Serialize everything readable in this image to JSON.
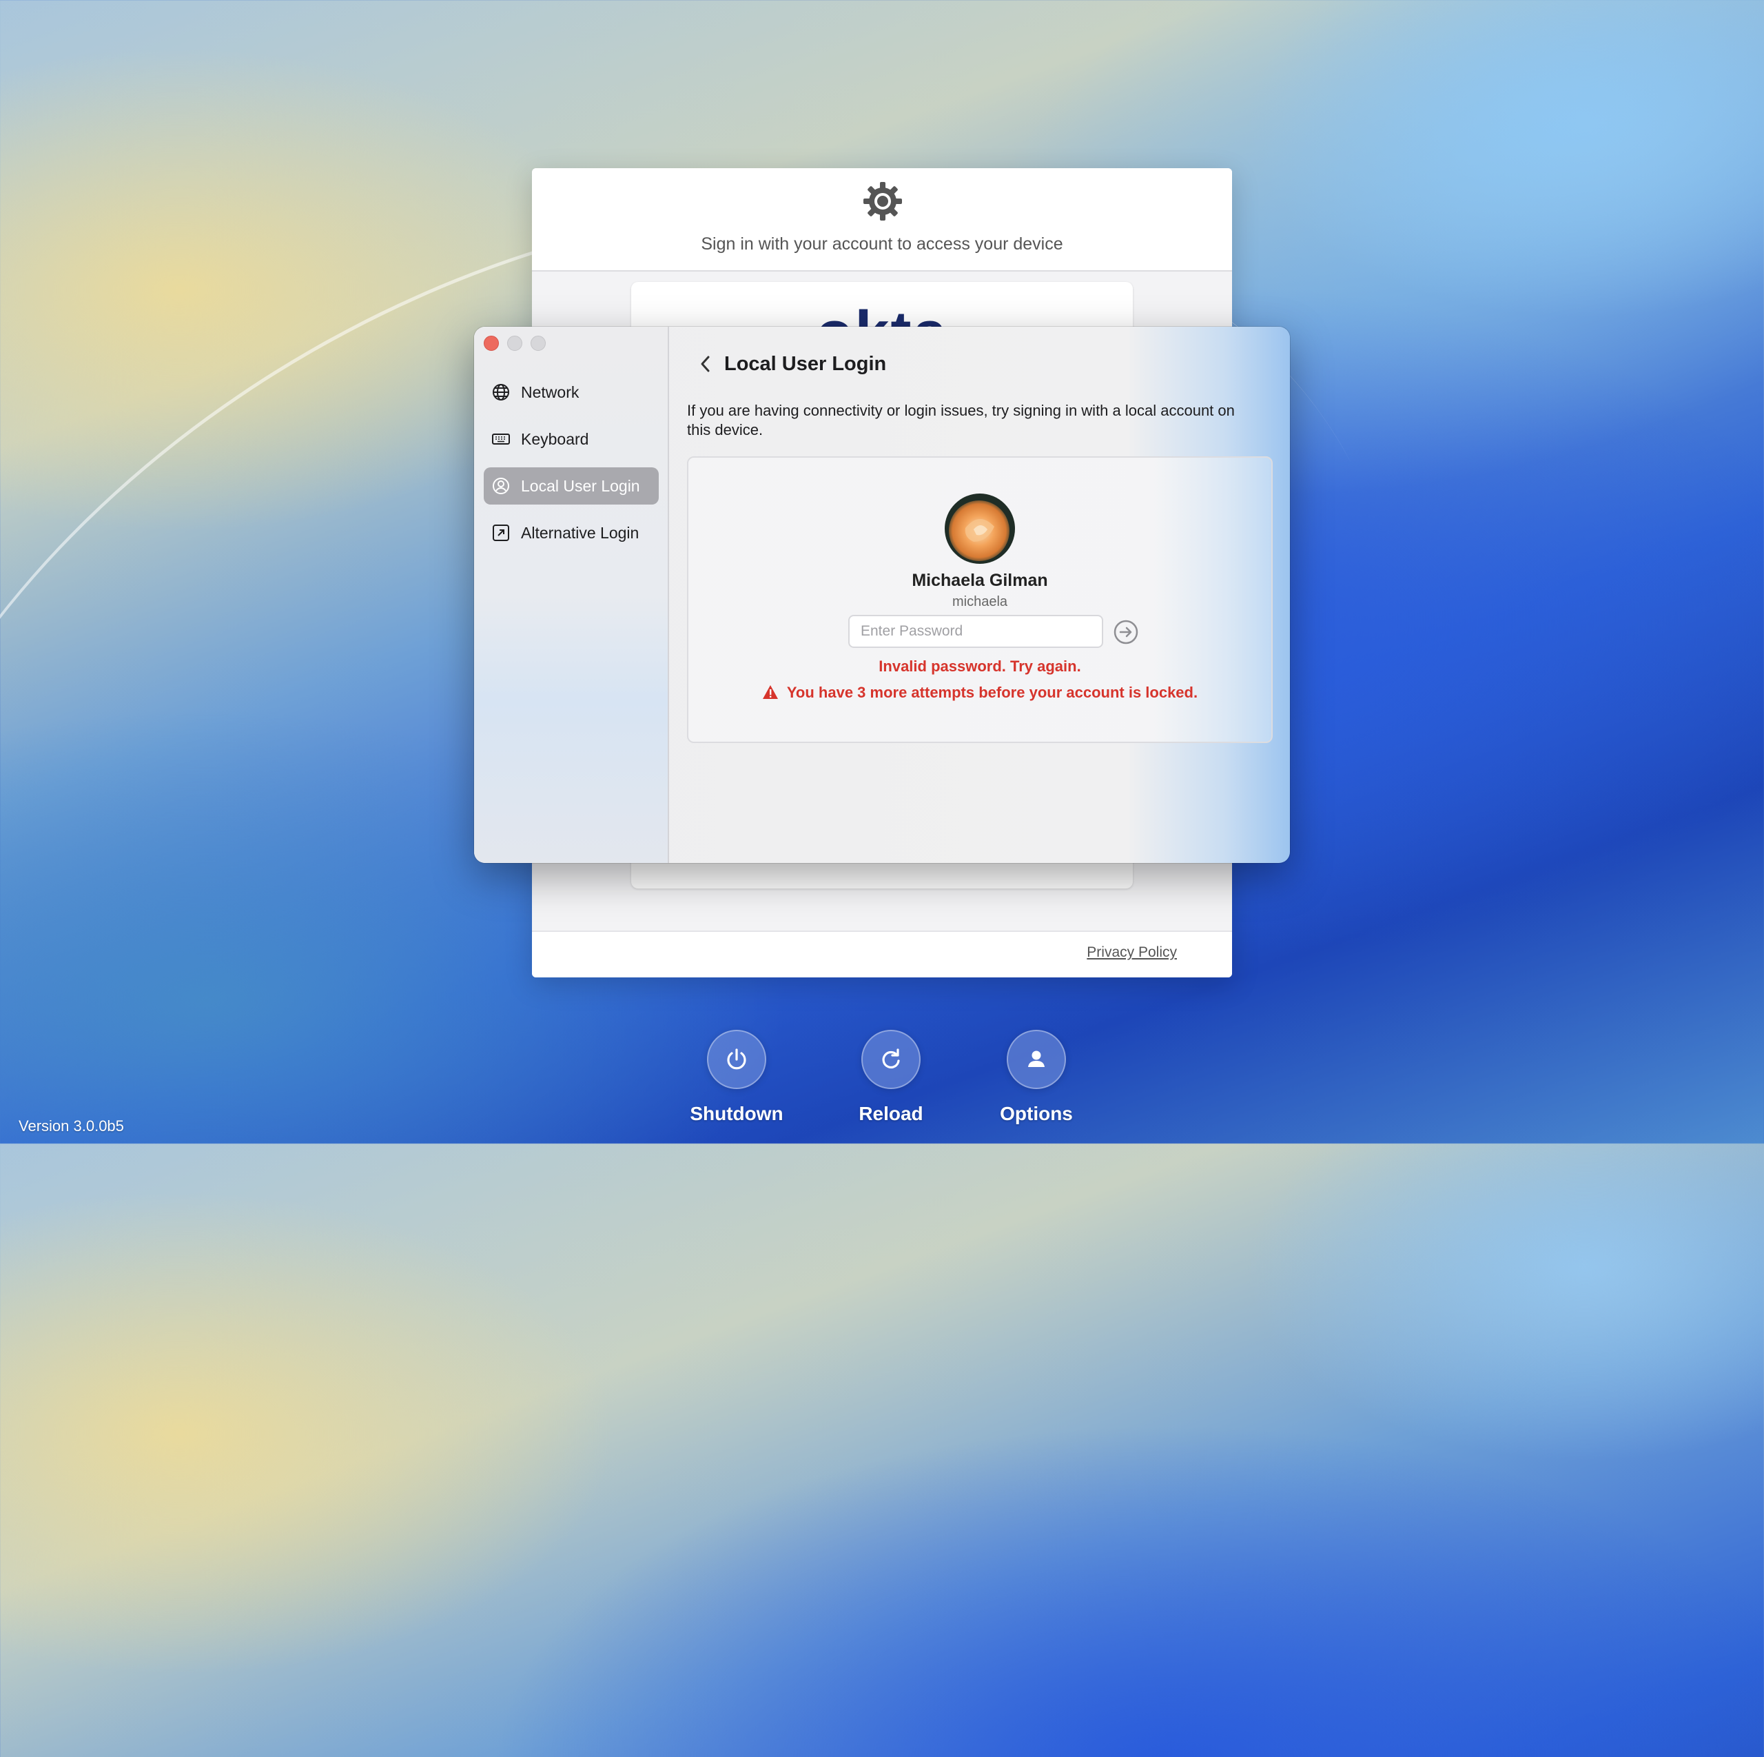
{
  "background": {
    "subtitle": "Sign in with your account to access your device",
    "okta_logo": "okta",
    "privacy_link": "Privacy Policy"
  },
  "dialog": {
    "sidebar": {
      "items": [
        {
          "label": "Network",
          "icon": "globe-icon",
          "active": false
        },
        {
          "label": "Keyboard",
          "icon": "keyboard-icon",
          "active": false
        },
        {
          "label": "Local User Login",
          "icon": "person-circle-icon",
          "active": true
        },
        {
          "label": "Alternative Login",
          "icon": "arrow-square-icon",
          "active": false
        }
      ]
    },
    "main": {
      "title": "Local User Login",
      "description": "If you are having connectivity or login issues, try signing in with a local account on this device.",
      "user": {
        "full_name": "Michaela Gilman",
        "username": "michaela"
      },
      "password": {
        "value": "",
        "placeholder": "Enter Password"
      },
      "error_message": "Invalid password. Try again.",
      "warning_message": "You have 3 more attempts before your account is locked."
    }
  },
  "controls": {
    "shutdown": "Shutdown",
    "reload": "Reload",
    "options": "Options"
  },
  "version": "Version 3.0.0b5",
  "colors": {
    "error": "#d6342c",
    "active_nav": "#a9a9ae",
    "close_button": "#ed6a5e"
  }
}
